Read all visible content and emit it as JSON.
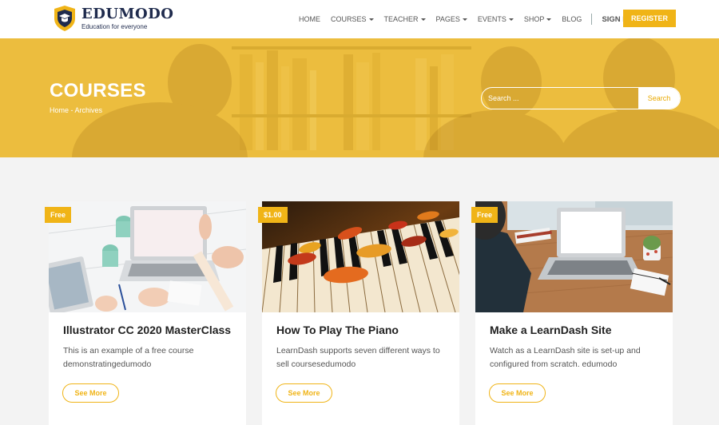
{
  "brand": {
    "name": "EDUMODO",
    "tagline": "Education for everyone",
    "accent": "#f0b417",
    "navy": "#1f2b4d"
  },
  "nav": {
    "items": [
      {
        "label": "HOME",
        "dropdown": false
      },
      {
        "label": "COURSES",
        "dropdown": true
      },
      {
        "label": "TEACHER",
        "dropdown": true
      },
      {
        "label": "PAGES",
        "dropdown": true
      },
      {
        "label": "EVENTS",
        "dropdown": true
      },
      {
        "label": "SHOP",
        "dropdown": true
      },
      {
        "label": "BLOG",
        "dropdown": false
      }
    ],
    "sign_in": "SIGN IN",
    "register": "REGISTER"
  },
  "hero": {
    "title": "COURSES",
    "breadcrumb": "Home - Archives",
    "search_placeholder": "Search ...",
    "search_button": "Search"
  },
  "courses": [
    {
      "badge": "Free",
      "title": "Illustrator CC 2020 MasterClass",
      "description": "This is an example of a free course demonstratingedumodo",
      "button": "See More",
      "image": "laptop-desk-icon"
    },
    {
      "badge": "$1.00",
      "title": "How To Play The Piano",
      "description": "LearnDash supports seven different ways to sell coursesedumodo",
      "button": "See More",
      "image": "piano-keys-icon"
    },
    {
      "badge": "Free",
      "title": "Make a LearnDash Site",
      "description": "Watch as a LearnDash site is set-up and configured from scratch. edumodo",
      "button": "See More",
      "image": "laptop-typing-icon"
    }
  ]
}
